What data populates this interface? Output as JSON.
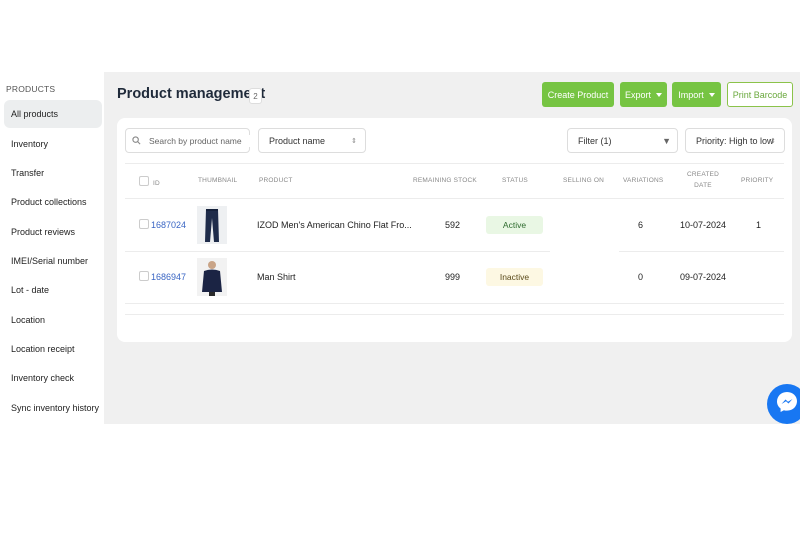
{
  "sidebar": {
    "heading": "PRODUCTS",
    "items": [
      {
        "label": "All products",
        "active": true
      },
      {
        "label": "Inventory"
      },
      {
        "label": "Transfer"
      },
      {
        "label": "Product collections"
      },
      {
        "label": "Product reviews"
      },
      {
        "label": "IMEI/Serial number"
      },
      {
        "label": "Lot - date"
      },
      {
        "label": "Location"
      },
      {
        "label": "Location receipt"
      },
      {
        "label": "Inventory check"
      },
      {
        "label": "Sync inventory history"
      }
    ]
  },
  "header": {
    "title": "Product management",
    "count": "2",
    "buttons": {
      "create": "Create Product",
      "export": "Export",
      "import": "Import",
      "print": "Print Barcode"
    }
  },
  "toolbar": {
    "search_placeholder": "Search by product name",
    "sort_field": "Product name",
    "filter": "Filter (1)",
    "priority_sort": "Priority: High to low"
  },
  "table": {
    "columns": {
      "id": "ID",
      "thumbnail": "THUMBNAIL",
      "product": "PRODUCT",
      "remaining_stock": "REMAINING STOCK",
      "status": "STATUS",
      "selling_on": "SELLING ON",
      "variations": "VARIATIONS",
      "created_date_line1": "CREATED",
      "created_date_line2": "DATE",
      "priority": "PRIORITY"
    },
    "rows": [
      {
        "id": "1687024",
        "product": "IZOD Men's American Chino Flat Fro...",
        "remaining_stock": "592",
        "status": "Active",
        "selling_on": "",
        "variations": "6",
        "created_date": "10-07-2024",
        "priority": "1",
        "thumbnail": "pants-thumbnail"
      },
      {
        "id": "1686947",
        "product": "Man Shirt",
        "remaining_stock": "999",
        "status": "Inactive",
        "selling_on": "",
        "variations": "0",
        "created_date": "09-07-2024",
        "priority": "",
        "thumbnail": "shirt-thumbnail"
      }
    ]
  },
  "colors": {
    "primary_green": "#76c442",
    "link_blue": "#3a66c4",
    "active_badge_bg": "#e9f7e4",
    "inactive_badge_bg": "#fdf8e3",
    "messenger_blue": "#1877f2"
  },
  "icons": {
    "search": "search-icon",
    "messenger": "messenger-icon"
  }
}
